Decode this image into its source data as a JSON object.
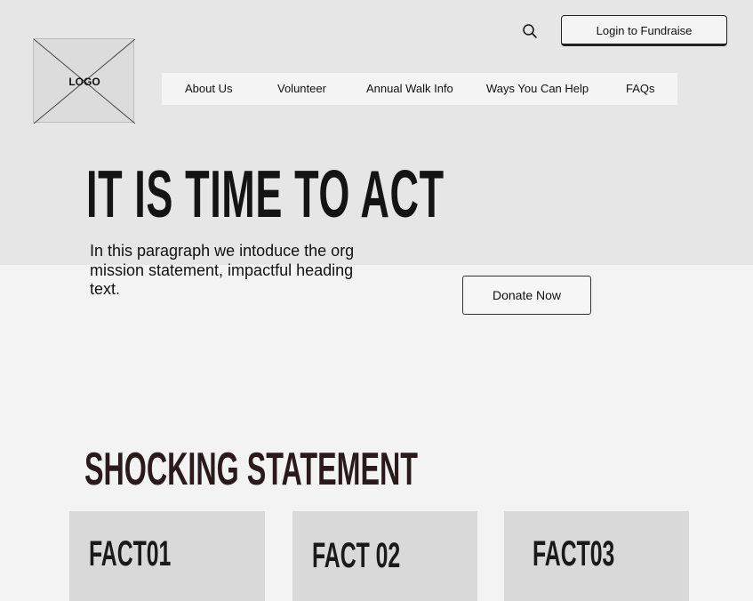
{
  "header": {
    "logo_text": "LOGO",
    "search_icon": "search-icon",
    "login_label": "Login to Fundraise"
  },
  "nav": {
    "items": [
      {
        "label": "About Us"
      },
      {
        "label": "Volunteer"
      },
      {
        "label": "Annual Walk Info"
      },
      {
        "label": "Ways You Can Help"
      },
      {
        "label": "FAQs"
      }
    ]
  },
  "hero": {
    "heading": "IT IS TIME TO ACT",
    "paragraph": "In this paragraph we intoduce the org mission statement, impactful heading text.",
    "donate_label": "Donate Now"
  },
  "facts_section": {
    "heading": "SHOCKING STATEMENT",
    "cards": [
      {
        "title": "FACT01"
      },
      {
        "title": "FACT 02"
      },
      {
        "title": "FACT03"
      }
    ]
  }
}
